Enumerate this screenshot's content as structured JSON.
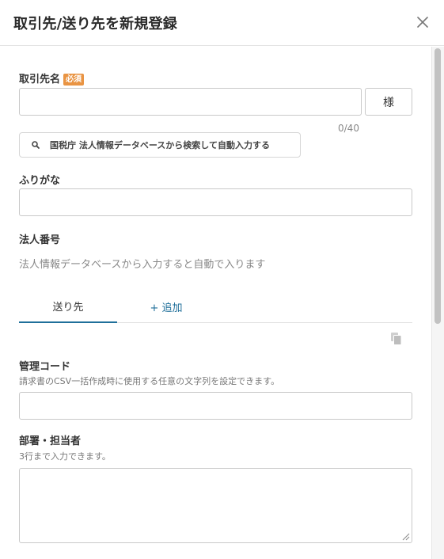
{
  "dialog": {
    "title": "取引先/送り先を新規登録"
  },
  "form": {
    "partner_name": {
      "label": "取引先名",
      "required_badge": "必須",
      "value": "",
      "suffix": "様",
      "counter": "0/40"
    },
    "search_button": {
      "label": "国税庁 法人情報データベースから検索して自動入力する",
      "icon": "search-icon"
    },
    "furigana": {
      "label": "ふりがな",
      "value": ""
    },
    "corporate_number": {
      "label": "法人番号",
      "hint": "法人情報データベースから入力すると自動で入ります"
    },
    "tabs": [
      {
        "label": "送り先",
        "active": true
      },
      {
        "label": "+ 追加",
        "active": false
      }
    ],
    "management_code": {
      "label": "管理コード",
      "hint": "請求書のCSV一括作成時に使用する任意の文字列を設定できます。",
      "value": ""
    },
    "department": {
      "label": "部署・担当者",
      "hint": "3行まで入力できます。",
      "value": ""
    }
  },
  "colors": {
    "accent": "#1f6f9a",
    "required_badge": "#e99443",
    "border": "#c9c9c9"
  }
}
